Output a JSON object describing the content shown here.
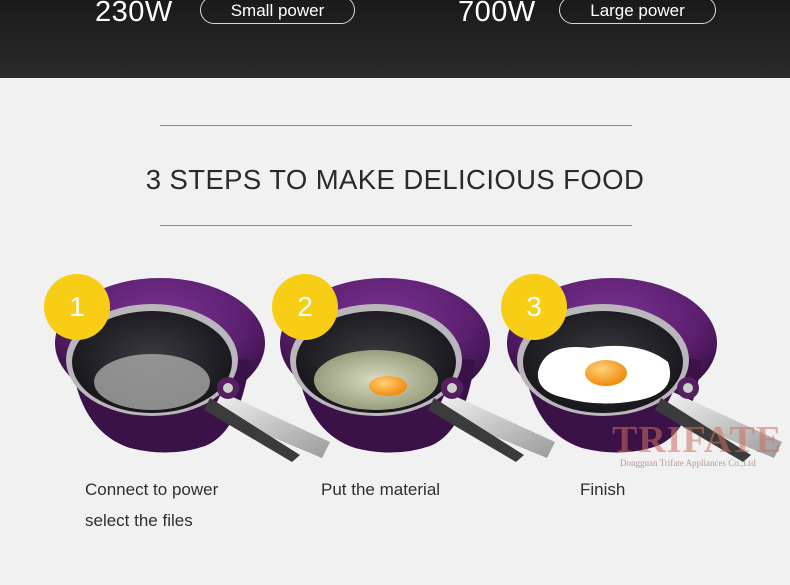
{
  "power": {
    "low_value": "230W",
    "low_label": "Small power",
    "high_value": "700W",
    "high_label": "Large power"
  },
  "headline": "3 STEPS TO MAKE DELICIOUS FOOD",
  "steps": [
    {
      "number": "1",
      "caption_line1": "Connect to power",
      "caption_line2": "select the files",
      "content": "water"
    },
    {
      "number": "2",
      "caption_line1": "Put the material",
      "content": "raw-egg"
    },
    {
      "number": "3",
      "caption_line1": "Finish",
      "content": "fried-egg"
    }
  ],
  "watermark": {
    "brand": "TRIFATE",
    "company": "Dongguan Trifate Appliances Co.,Ltd"
  },
  "colors": {
    "badge": "#f7cd15",
    "pot_purple": "#5a1f6e",
    "top_bar": "#222222",
    "background": "#f1f1f1"
  }
}
